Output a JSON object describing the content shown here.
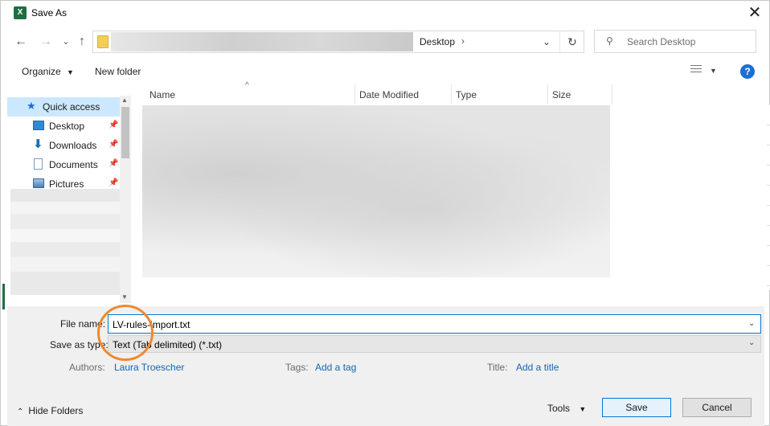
{
  "window": {
    "title": "Save As",
    "app_icon_letter": "X"
  },
  "nav": {
    "back": "←",
    "forward": "→",
    "recent": "⌄",
    "up": "↑"
  },
  "address": {
    "current_folder": "Desktop",
    "separator": "›"
  },
  "search": {
    "placeholder": "Search Desktop"
  },
  "toolbar": {
    "organize": "Organize",
    "new_folder": "New folder",
    "help": "?"
  },
  "nav_pane": {
    "items": [
      {
        "label": "Quick access",
        "pinned": false
      },
      {
        "label": "Desktop",
        "pinned": true
      },
      {
        "label": "Downloads",
        "pinned": true
      },
      {
        "label": "Documents",
        "pinned": true
      },
      {
        "label": "Pictures",
        "pinned": true
      }
    ]
  },
  "columns": {
    "name": "Name",
    "date_modified": "Date Modified",
    "type": "Type",
    "size": "Size"
  },
  "form": {
    "file_name_label": "File name:",
    "file_name_value": "LV-rules-import.txt",
    "save_as_type_label": "Save as type:",
    "save_as_type_value": "Text (Tab delimited) (*.txt)",
    "authors_label": "Authors:",
    "authors_value": "Laura Troescher",
    "tags_label": "Tags:",
    "tags_value": "Add a tag",
    "title_label": "Title:",
    "title_value": "Add a title"
  },
  "footer": {
    "hide_folders": "Hide Folders",
    "tools": "Tools",
    "save": "Save",
    "cancel": "Cancel"
  },
  "colors": {
    "accent": "#0078d7",
    "selected": "#cce8ff",
    "annotation_circle": "#f0892c",
    "link": "#1464b4"
  }
}
